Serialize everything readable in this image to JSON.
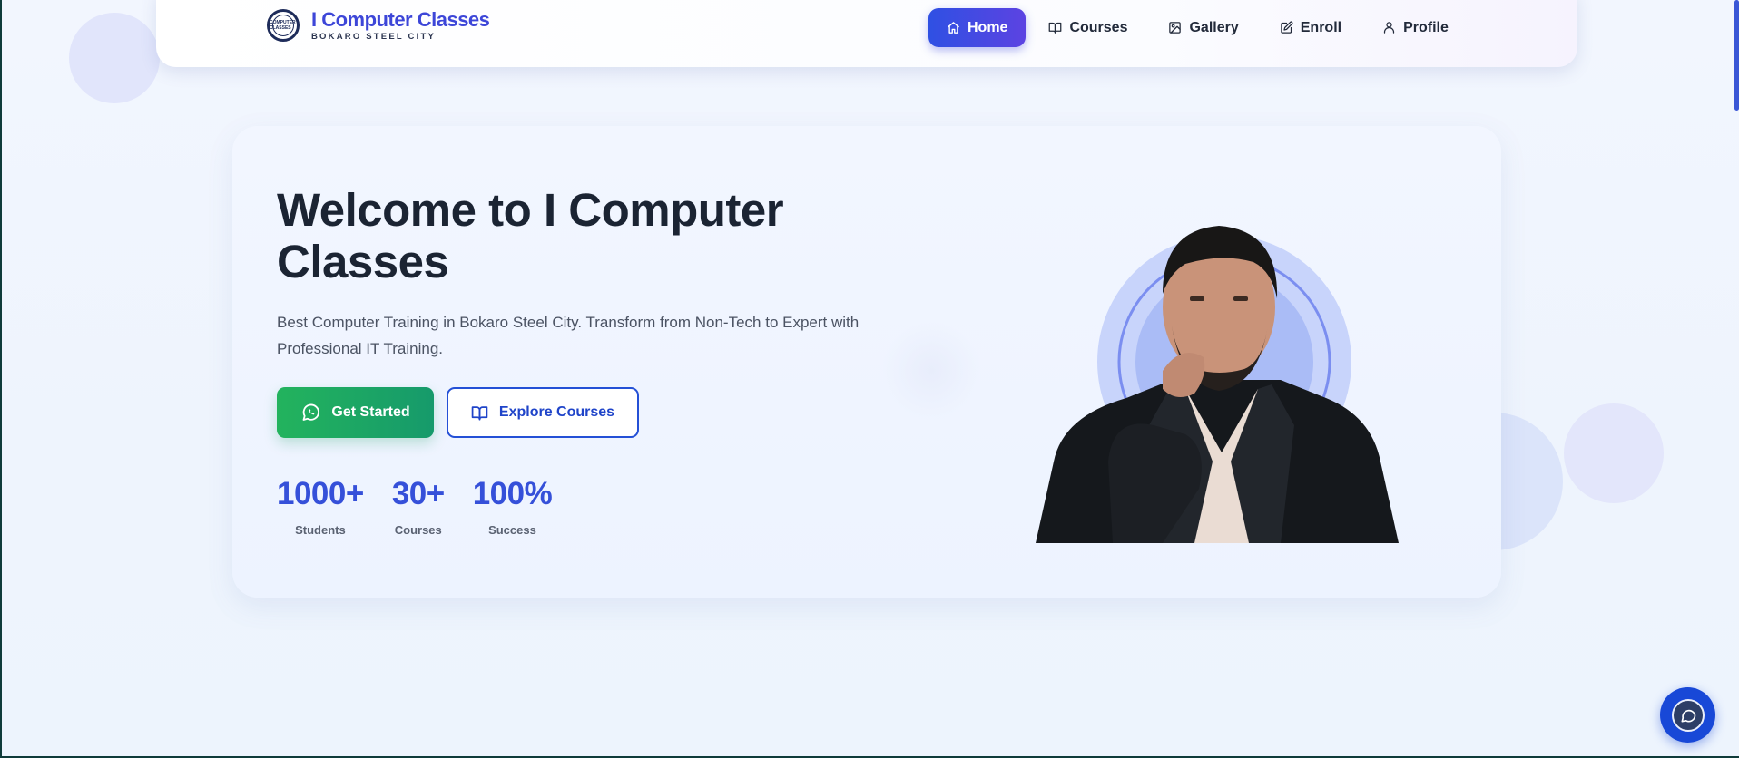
{
  "brand": {
    "logo_text": "COMPUTER CLASSES",
    "title": "I Computer Classes",
    "subtitle": "BOKARO STEEL CITY"
  },
  "nav": {
    "items": [
      {
        "label": "Home",
        "icon": "home-icon",
        "active": true
      },
      {
        "label": "Courses",
        "icon": "book-icon",
        "active": false
      },
      {
        "label": "Gallery",
        "icon": "image-icon",
        "active": false
      },
      {
        "label": "Enroll",
        "icon": "edit-icon",
        "active": false
      },
      {
        "label": "Profile",
        "icon": "user-icon",
        "active": false
      }
    ]
  },
  "hero": {
    "title": "Welcome to I Computer Classes",
    "description": "Best Computer Training in Bokaro Steel City. Transform from Non-Tech to Expert with Professional IT Training.",
    "primary_cta": "Get Started",
    "primary_cta_icon": "whatsapp-icon",
    "secondary_cta": "Explore Courses",
    "secondary_cta_icon": "book-icon",
    "stats": [
      {
        "value": "1000+",
        "label": "Students"
      },
      {
        "value": "30+",
        "label": "Courses"
      },
      {
        "value": "100%",
        "label": "Success"
      }
    ]
  },
  "chat": {
    "icon": "chat-icon"
  },
  "colors": {
    "accent": "#3550d9",
    "nav_active": "#2f50e3",
    "cta_green": "#23b35d",
    "heading": "#1b2433"
  }
}
